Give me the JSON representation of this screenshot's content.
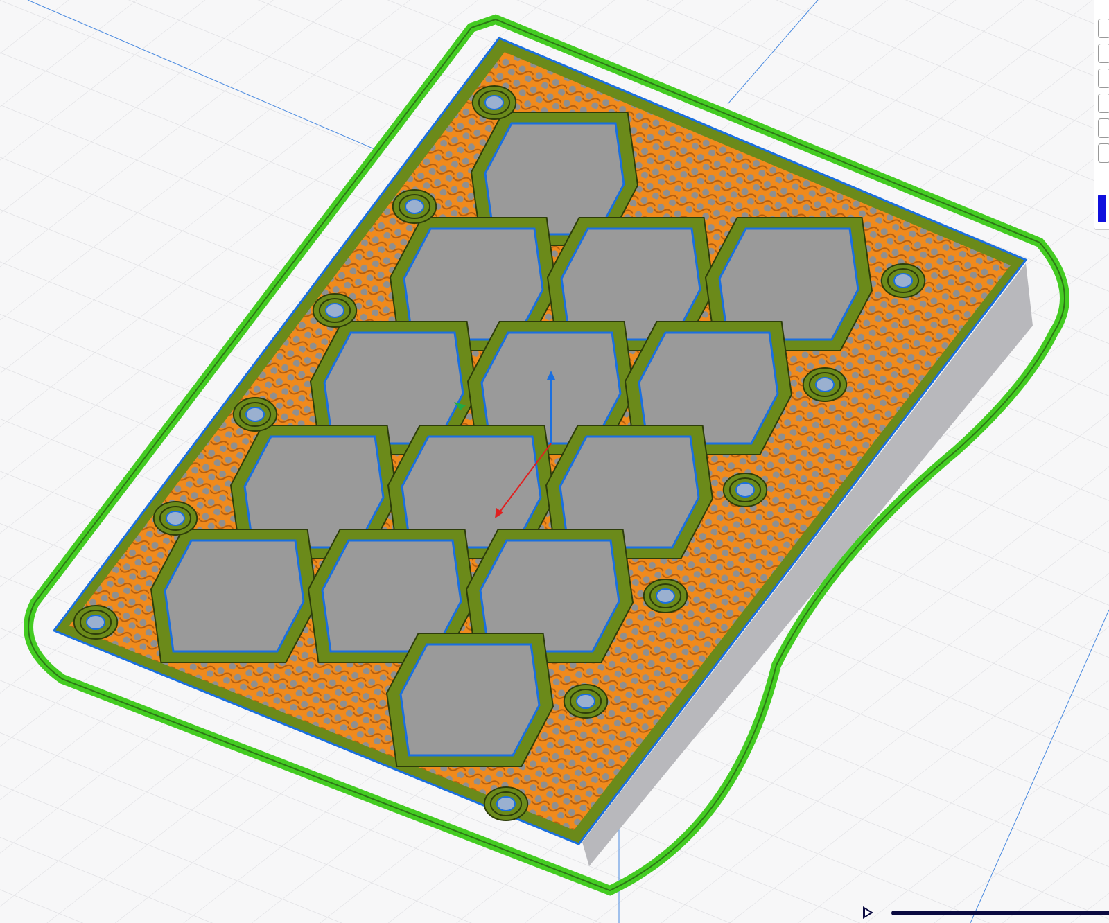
{
  "colors": {
    "skirt": "#44cc22",
    "infill": "#f08a1c",
    "wall": "#7a9a20",
    "outline": "#1a6fe0",
    "hole": "#9a9a9a",
    "background": "#f7f7f8",
    "slider": "#0a0a40"
  },
  "side_panel": {
    "checkbox_count": 6
  },
  "layer_slider": {
    "progress": 1.0
  },
  "icons": {
    "play": "play-icon"
  }
}
